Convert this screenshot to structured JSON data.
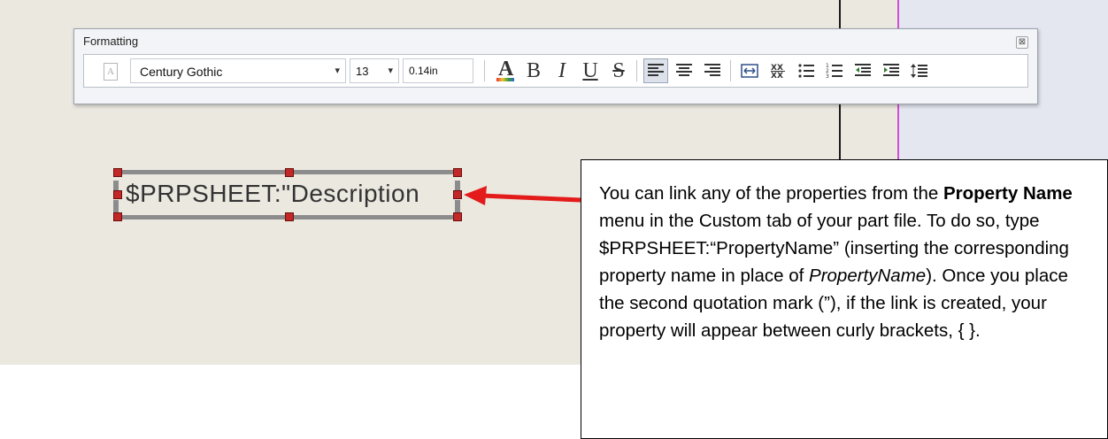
{
  "toolbar": {
    "title": "Formatting",
    "close_glyph": "⊠",
    "font_name": "Century Gothic",
    "font_size": "13",
    "text_height": "0.14in",
    "dropdown_arrow": "▾",
    "icons": [
      "font-style-icon",
      "font-color-icon",
      "bold-icon",
      "italic-icon",
      "underline-icon",
      "strikethrough-icon",
      "align-left-icon",
      "align-center-icon",
      "align-right-icon",
      "fit-text-icon",
      "stack-icon",
      "bullets-icon",
      "numbering-icon",
      "decrease-indent-icon",
      "increase-indent-icon",
      "line-spacing-icon"
    ],
    "glyphs": {
      "color": "A",
      "bold": "B",
      "italic": "I",
      "underline": "U",
      "strike": "S"
    }
  },
  "sheet": {
    "note_text": "$PRPSHEET:\"Description"
  },
  "callout": {
    "p1": "You can link any of the properties from the ",
    "bold1": "Property Name",
    "p2": " menu in the Custom tab of your part file.  To do so, type $PRPSHEET:“PropertyName” (inserting the corresponding property name in place of ",
    "italic1": "PropertyName",
    "p3": "). Once you place the second quotation mark (”), if the link is created, your property will appear between curly brackets, { }."
  },
  "colors": {
    "canvas": "#ebe8e0",
    "handle": "#c22828",
    "arrow": "#e31b1b",
    "sketch_line_magenta": "#d14fd6"
  }
}
